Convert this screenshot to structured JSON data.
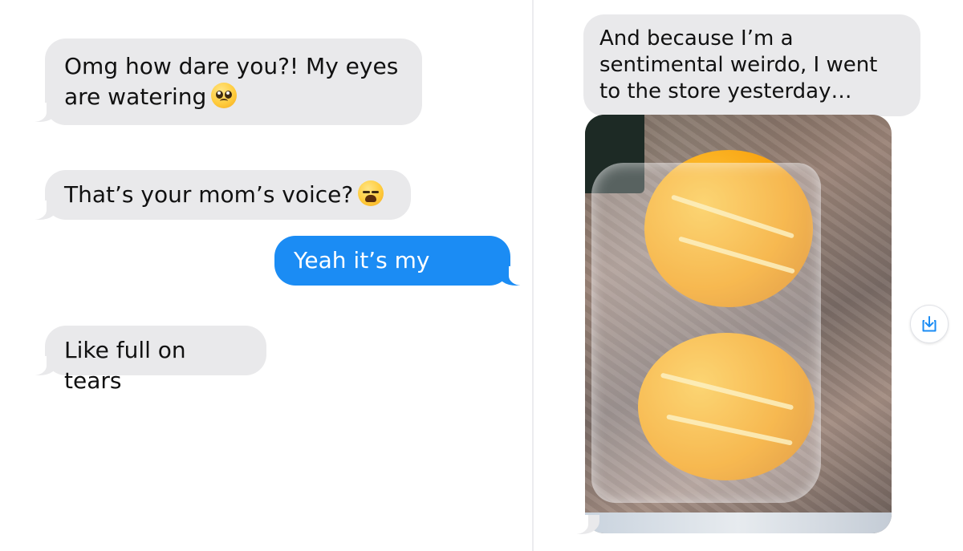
{
  "left_conversation": {
    "messages": [
      {
        "direction": "incoming",
        "text": "Omg how dare you?! My eyes are watering",
        "emoji": "pleading-face"
      },
      {
        "direction": "incoming",
        "text": "That’s your mom’s voice?",
        "emoji": "weary-face"
      },
      {
        "direction": "outgoing",
        "text": "Yeah it’s my mom"
      },
      {
        "direction": "incoming",
        "text": "Like full on tears"
      }
    ]
  },
  "right_conversation": {
    "messages": [
      {
        "direction": "incoming",
        "text": "And because I’m a sentimental weirdo, I went to the store yesterday…"
      },
      {
        "direction": "incoming",
        "type": "photo",
        "photo_subject": "two-oranges-wrapped-in-plastic"
      }
    ],
    "save_icon": "save-download-icon"
  },
  "colors": {
    "incoming_bubble": "#e9e9eb",
    "outgoing_bubble": "#1b8cf4",
    "save_icon": "#1b8cf4"
  }
}
